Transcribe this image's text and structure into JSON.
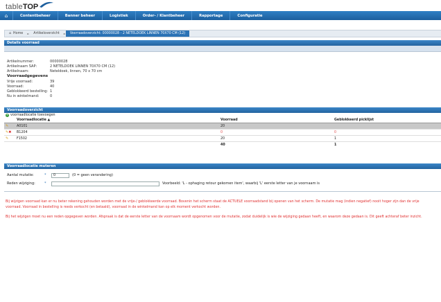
{
  "logo": {
    "part1": "table",
    "part2": "TOP"
  },
  "nav": [
    "Contentbeheer",
    "Banner beheer",
    "Logistiek",
    "Order- / Klantbeheer",
    "Rapportage",
    "Configuratie"
  ],
  "breadcrumb": [
    "Home",
    "Artikeloverzicht",
    "Voorraadoverzicht: 00000028 - 2 NETELDOEK LINNEN 70X70 CM (12)"
  ],
  "details": {
    "title": "Details voorraad",
    "rows": [
      {
        "k": "Artikelnummer:",
        "v": "00000028"
      },
      {
        "k": "Artikelnaam SAP:",
        "v": "2 NETELDOEK LINNEN 70X70 CM (12)"
      },
      {
        "k": "Artikelnaam:",
        "v": "Neteldoek, linnen, 70 x 70 cm"
      }
    ],
    "sub": "Voorraadgegevens",
    "stock": [
      {
        "k": "Vrije voorraad:",
        "v": "39"
      },
      {
        "k": "Voorraad:",
        "v": "40"
      },
      {
        "k": "Geblokkeerd bestelling:",
        "v": "1"
      },
      {
        "k": "Nu in winkelmand:",
        "v": "0"
      }
    ]
  },
  "overview": {
    "title": "Voorraadoverzicht",
    "add_label": "voorraadlocatie toevoegen",
    "headers": [
      "Voorraadlocatie ▲",
      "Voorraad",
      "Geblokkeerd picklijst"
    ],
    "rows": [
      {
        "loc": "A0101",
        "stock": "20",
        "blocked": "",
        "selected": true,
        "deletable": false,
        "red": false
      },
      {
        "loc": "B1204",
        "stock": "0",
        "blocked": "0",
        "selected": false,
        "deletable": true,
        "red": true
      },
      {
        "loc": "F1502",
        "stock": "20",
        "blocked": "1",
        "selected": false,
        "deletable": false,
        "red": false
      }
    ],
    "totals": {
      "stock": "40",
      "blocked": "1"
    }
  },
  "mutate": {
    "title": "Voorraadlocatie muteren",
    "amount_label": "Aantal mutatie:",
    "amount_value": "0",
    "amount_hint": "(0 = geen verandering)",
    "reason_label": "Reden wijziging:",
    "reason_value": "",
    "reason_hint": "Voorbeeld: 'L - ophaging retour gekomen item', waarbij 'L' eerste letter van je voornaam is",
    "req": "*"
  },
  "notes": [
    "Bij wijzigen voorraad kan er nu beter rekening gehouden worden met de vrije-/ geblokkeerde voorraad. Bovenin het scherm staat de ACTUELE voorraadstand bij openen van het scherm. De mutatie mag (indien negatief) nooit hoger zijn dan de vrije voorraad. Voorraad in bestelling is reeds verkocht (en betaald), voorraad in de winkelmand kan op elk moment verkocht worden.",
    "Bij het wijzigen moet nu een reden opgegeven worden. Afspraak is dat de eerste letter van de voornaam wordt opgenomen voor de mutatie, zodat duidelijk is wie de wijziging gedaan heeft, en waarom deze gedaan is. Dit geeft achteraf beter inzicht."
  ]
}
